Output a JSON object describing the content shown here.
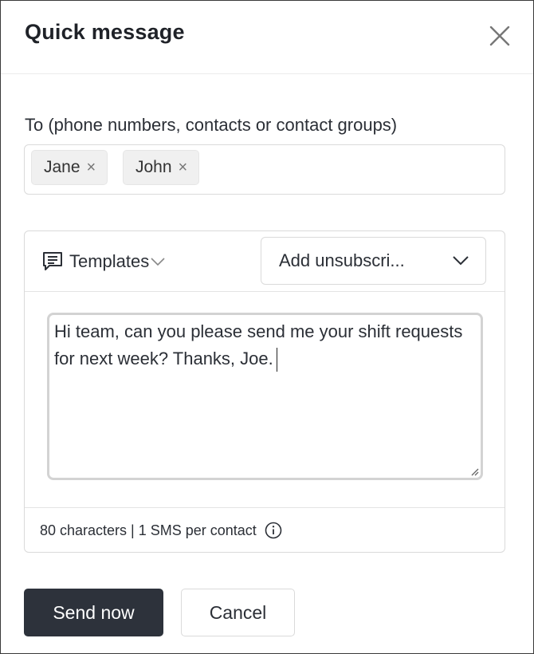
{
  "dialog": {
    "title": "Quick message",
    "close_icon": "close-icon"
  },
  "recipients": {
    "label": "To (phone numbers, contacts or contact groups)",
    "chips": [
      {
        "name": "Jane",
        "remove": "×"
      },
      {
        "name": "John",
        "remove": "×"
      }
    ]
  },
  "composer": {
    "templates_label": "Templates",
    "templates_icon": "message-template-icon",
    "unsubscribe_select": "Add unsubscri...",
    "message": "Hi team, can you please send me your shift requests for next week? Thanks, Joe.",
    "count_text": "80 characters | 1 SMS per contact",
    "info_icon": "info-icon"
  },
  "actions": {
    "send_label": "Send now",
    "cancel_label": "Cancel"
  },
  "colors": {
    "primary_button": "#2d323b",
    "border": "#dadada",
    "chip_bg": "#f0f0f0"
  }
}
